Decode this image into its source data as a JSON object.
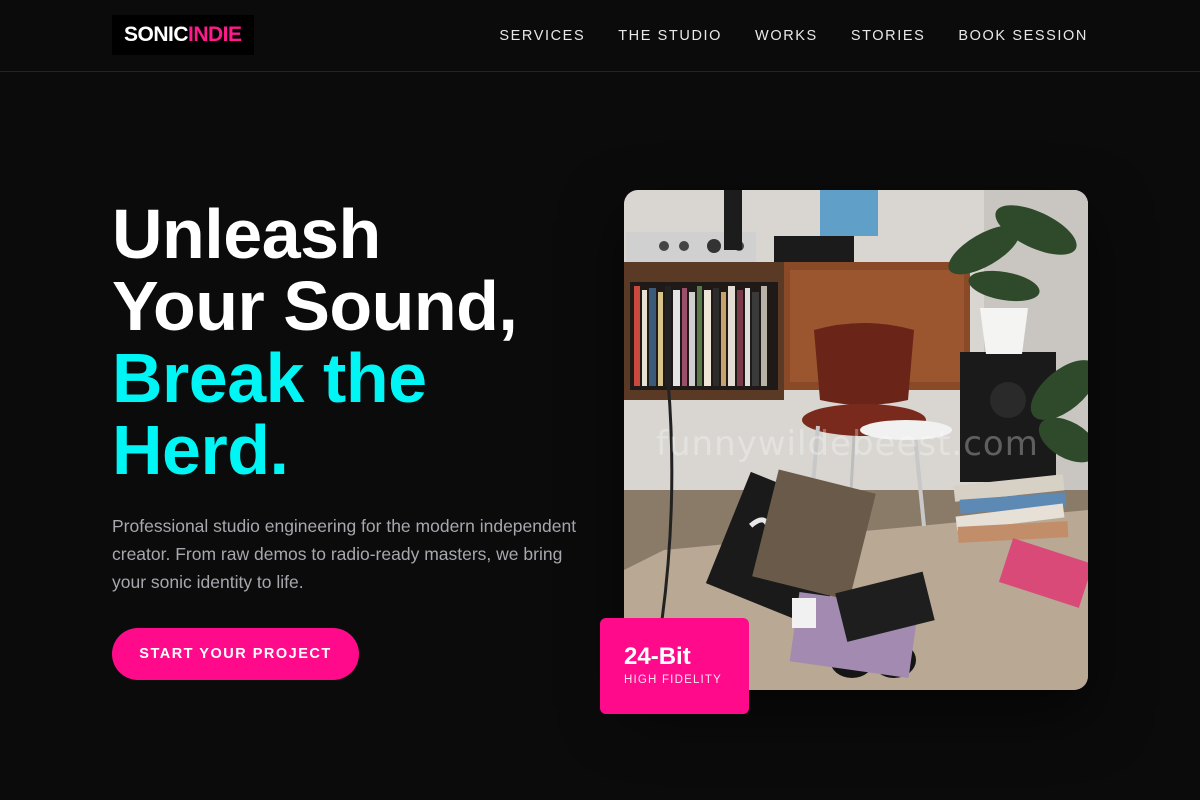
{
  "brand": {
    "name_part1": "SONIC",
    "name_part2": "INDIE",
    "accent_color": "#ff0a8b",
    "highlight_color": "#00f5f5"
  },
  "nav": {
    "items": [
      {
        "label": "SERVICES"
      },
      {
        "label": "THE STUDIO"
      },
      {
        "label": "WORKS"
      },
      {
        "label": "STORIES"
      },
      {
        "label": "BOOK SESSION"
      }
    ]
  },
  "hero": {
    "title_lines": [
      "Unleash",
      "Your Sound,",
      "Break the",
      "Herd."
    ],
    "description": "Professional studio engineering for the modern independent creator. From raw demos to radio-ready masters, we bring your sonic identity to life.",
    "cta_label": "START YOUR PROJECT"
  },
  "feature_image": {
    "watermark": "funnywildebeest.com",
    "badge": {
      "value": "24-Bit",
      "label": "HIGH FIDELITY"
    }
  }
}
